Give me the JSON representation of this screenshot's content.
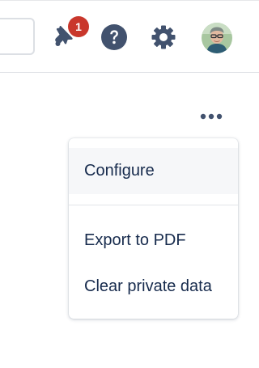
{
  "header": {
    "notifications": {
      "icon": "bell-icon",
      "badge_count": "1",
      "badge_color": "#c9372c"
    },
    "help": {
      "icon": "question-circle-icon"
    },
    "settings": {
      "icon": "gear-icon"
    },
    "profile": {
      "icon": "avatar"
    }
  },
  "more_actions": {
    "icon": "ellipsis-icon"
  },
  "dropdown_menu": {
    "items": [
      {
        "label": "Configure"
      },
      {
        "label": "Export to PDF"
      },
      {
        "label": "Clear private data"
      }
    ]
  },
  "colors": {
    "icon": "#42526e",
    "text": "#172b4d",
    "highlight": "#f6f7f9"
  }
}
